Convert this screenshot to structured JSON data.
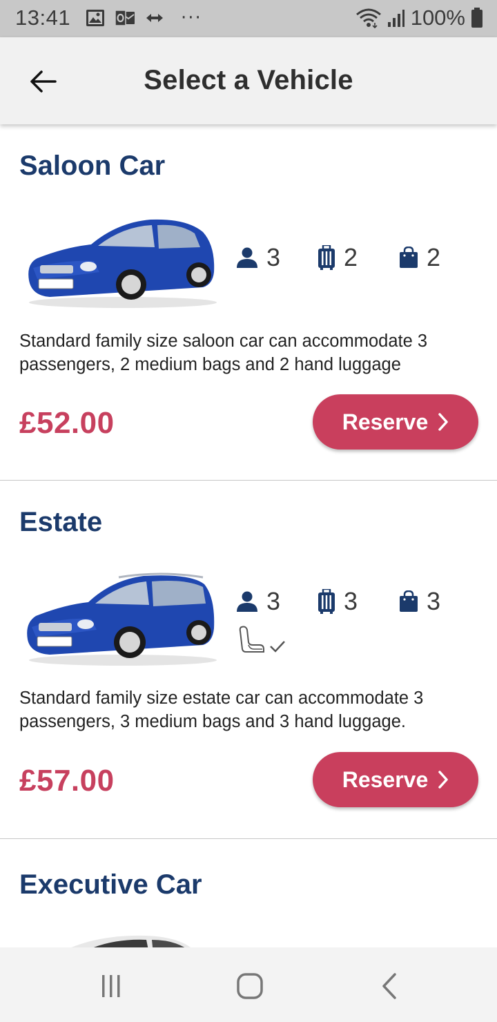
{
  "status_bar": {
    "time": "13:41",
    "left_icons": [
      "image-icon",
      "outlook-icon",
      "data-arrows-icon"
    ],
    "more": "···",
    "battery": "100%"
  },
  "app_bar": {
    "title": "Select a Vehicle",
    "back_icon": "arrow-left-icon"
  },
  "vehicles": [
    {
      "name": "Saloon Car",
      "passengers": "3",
      "medium_bags": "2",
      "hand_luggage": "2",
      "child_seat": false,
      "description": "Standard family size saloon car can accommodate 3 passengers, 2 medium bags and 2 hand luggage",
      "price": "£52.00",
      "reserve_label": "Reserve"
    },
    {
      "name": "Estate",
      "passengers": "3",
      "medium_bags": "3",
      "hand_luggage": "3",
      "child_seat": true,
      "description": "Standard family size estate car can accommodate 3 passengers, 3 medium bags and 3 hand luggage.",
      "price": "£57.00",
      "reserve_label": "Reserve"
    },
    {
      "name": "Executive Car"
    }
  ],
  "colors": {
    "brand_navy": "#1b3a6b",
    "accent_red": "#c93f5d",
    "price_red": "#c7405e"
  },
  "nav_bar": {
    "icons": [
      "recents-icon",
      "home-icon",
      "back-icon"
    ]
  }
}
